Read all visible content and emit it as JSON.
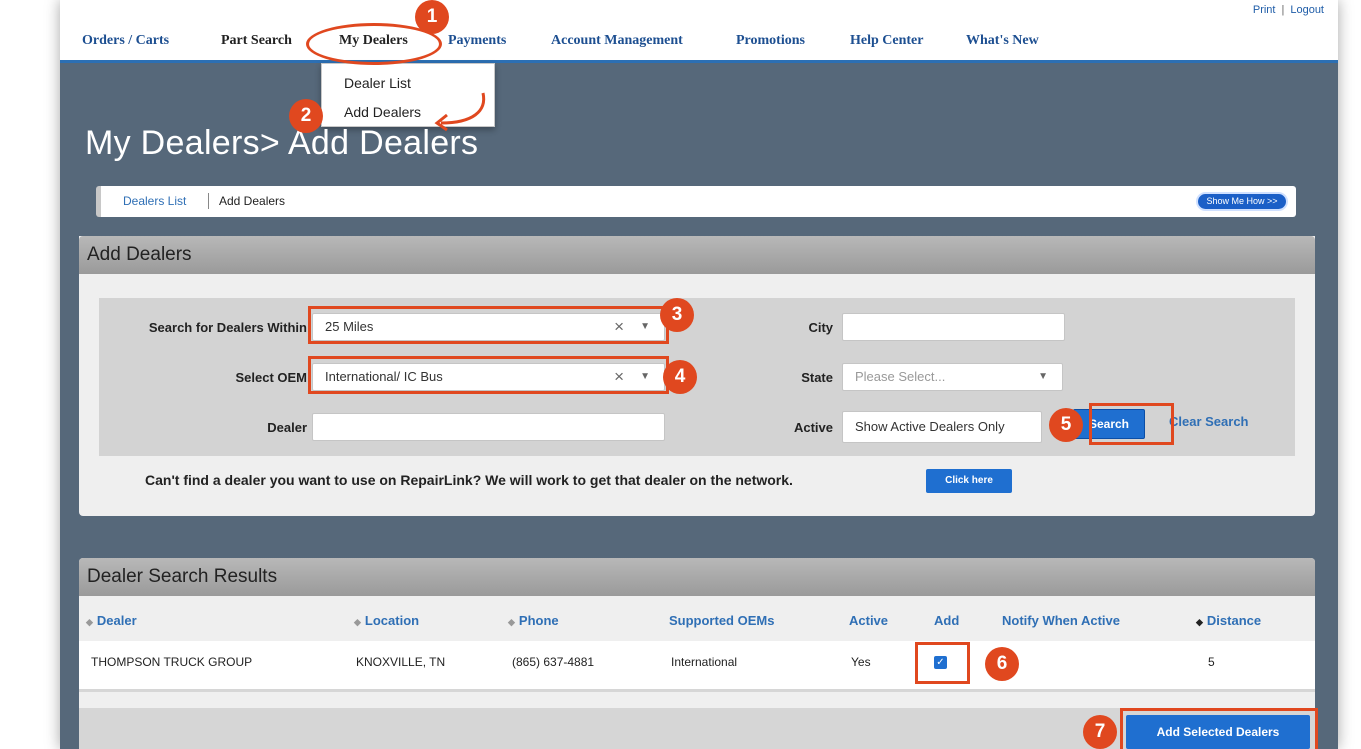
{
  "nav": {
    "util_print": "Print",
    "util_logout": "Logout",
    "items": [
      "Orders / Carts",
      "Part Search",
      "My Dealers",
      "Payments",
      "Account Management",
      "Promotions",
      "Help Center",
      "What's New"
    ]
  },
  "dropdown": {
    "items": [
      "Dealer List",
      "Add Dealers"
    ]
  },
  "page_title": "My Dealers> Add Dealers",
  "subnav": {
    "dealers_list": "Dealers List",
    "add_dealers": "Add Dealers",
    "show_me_how": "Show Me How >>"
  },
  "add_panel": {
    "title": "Add Dealers",
    "labels": {
      "within": "Search for Dealers Within",
      "oem": "Select OEM",
      "dealer": "Dealer",
      "city": "City",
      "state": "State",
      "active": "Active"
    },
    "values": {
      "within": "25 Miles",
      "oem": "International/ IC Bus",
      "dealer": "",
      "city": "",
      "state_placeholder": "Please Select...",
      "active": "Show Active Dealers Only"
    },
    "search_button": "Search",
    "clear_search": "Clear Search",
    "cant_find": "Can't find a dealer you want to use on RepairLink? We will work to get that dealer on the network.",
    "click_here": "Click here"
  },
  "results": {
    "title": "Dealer Search Results",
    "columns": [
      "Dealer",
      "Location",
      "Phone",
      "Supported OEMs",
      "Active",
      "Add",
      "Notify When Active",
      "Distance"
    ],
    "rows": [
      {
        "dealer": "THOMPSON TRUCK GROUP",
        "location": "KNOXVILLE, TN",
        "phone": "(865) 637-4881",
        "oems": "International",
        "active": "Yes",
        "add_checked": true,
        "notify": "",
        "distance": "5"
      }
    ],
    "add_selected": "Add Selected Dealers"
  },
  "annotations": [
    "1",
    "2",
    "3",
    "4",
    "5",
    "6",
    "7"
  ],
  "colors": {
    "accent": "#e0481f",
    "primary_blue": "#1f6fd0",
    "link_blue": "#2f6fb5",
    "page_bg": "#56687a"
  }
}
